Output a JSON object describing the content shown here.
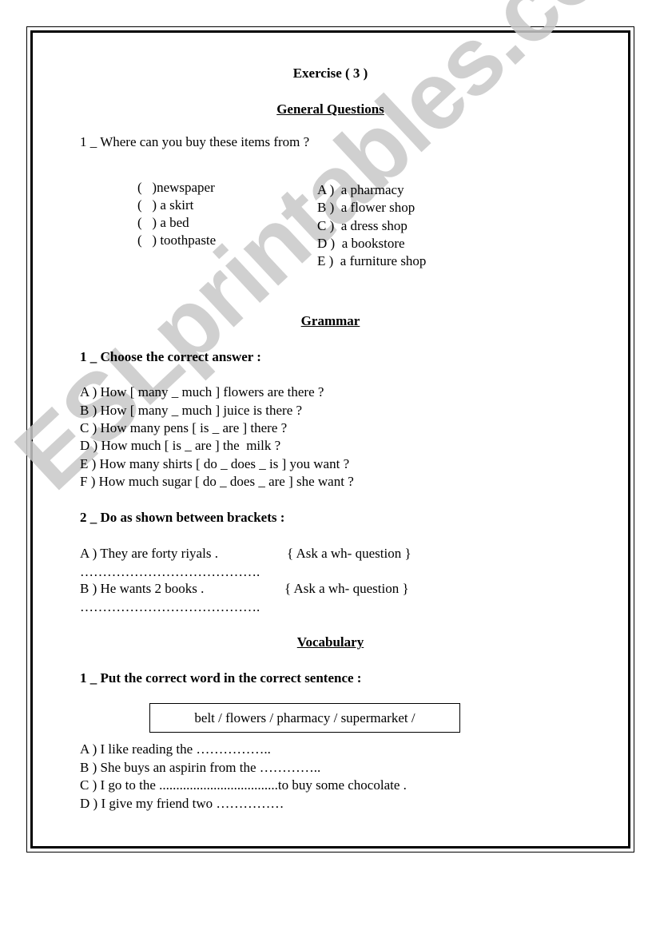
{
  "watermark": "ESLprintables.com",
  "title": "Exercise  ( 3 )",
  "sections": {
    "general": {
      "heading": "General Questions",
      "q1": {
        "prompt": "1 _ Where can you buy these items from ?",
        "items": [
          "(   )newspaper",
          "(   ) a skirt",
          "(   ) a bed",
          "(   ) toothpaste"
        ],
        "options": [
          "A )  a pharmacy",
          "B )  a flower shop",
          "C )  a dress shop",
          "D )  a bookstore",
          "E )  a furniture shop"
        ]
      }
    },
    "grammar": {
      "heading": "Grammar",
      "q1": {
        "prompt": "1 _ Choose the correct answer :",
        "items": [
          "A ) How [ many _ much ] flowers are there ?",
          "B ) How [ many _ much ] juice is there ?",
          "C ) How many pens [ is _ are ] there ?",
          "D ) How much [ is _ are ] the  milk ?",
          "E ) How many shirts [ do _ does _ is ] you want ?",
          "F ) How much sugar [ do _ does _ are ] she want ?"
        ]
      },
      "q2": {
        "prompt": "2 _ Do as shown between brackets :",
        "items": [
          {
            "sentence": "A ) They are forty riyals .",
            "instruction": "{ Ask a wh- question }",
            "answer_line": "…………………………………."
          },
          {
            "sentence": "B ) He wants 2 books .",
            "instruction": "{ Ask a wh- question }",
            "answer_line": "…………………………………."
          }
        ]
      }
    },
    "vocabulary": {
      "heading": "Vocabulary",
      "q1": {
        "prompt": "1 _ Put the correct word in the correct sentence :",
        "word_box": "belt / flowers / pharmacy / supermarket /",
        "items": [
          "A ) I like reading the ……………..",
          "B ) She buys an aspirin from the …………..",
          "C ) I go to the ...................................to buy some chocolate .",
          "D ) I give my friend two ……………"
        ]
      }
    }
  }
}
